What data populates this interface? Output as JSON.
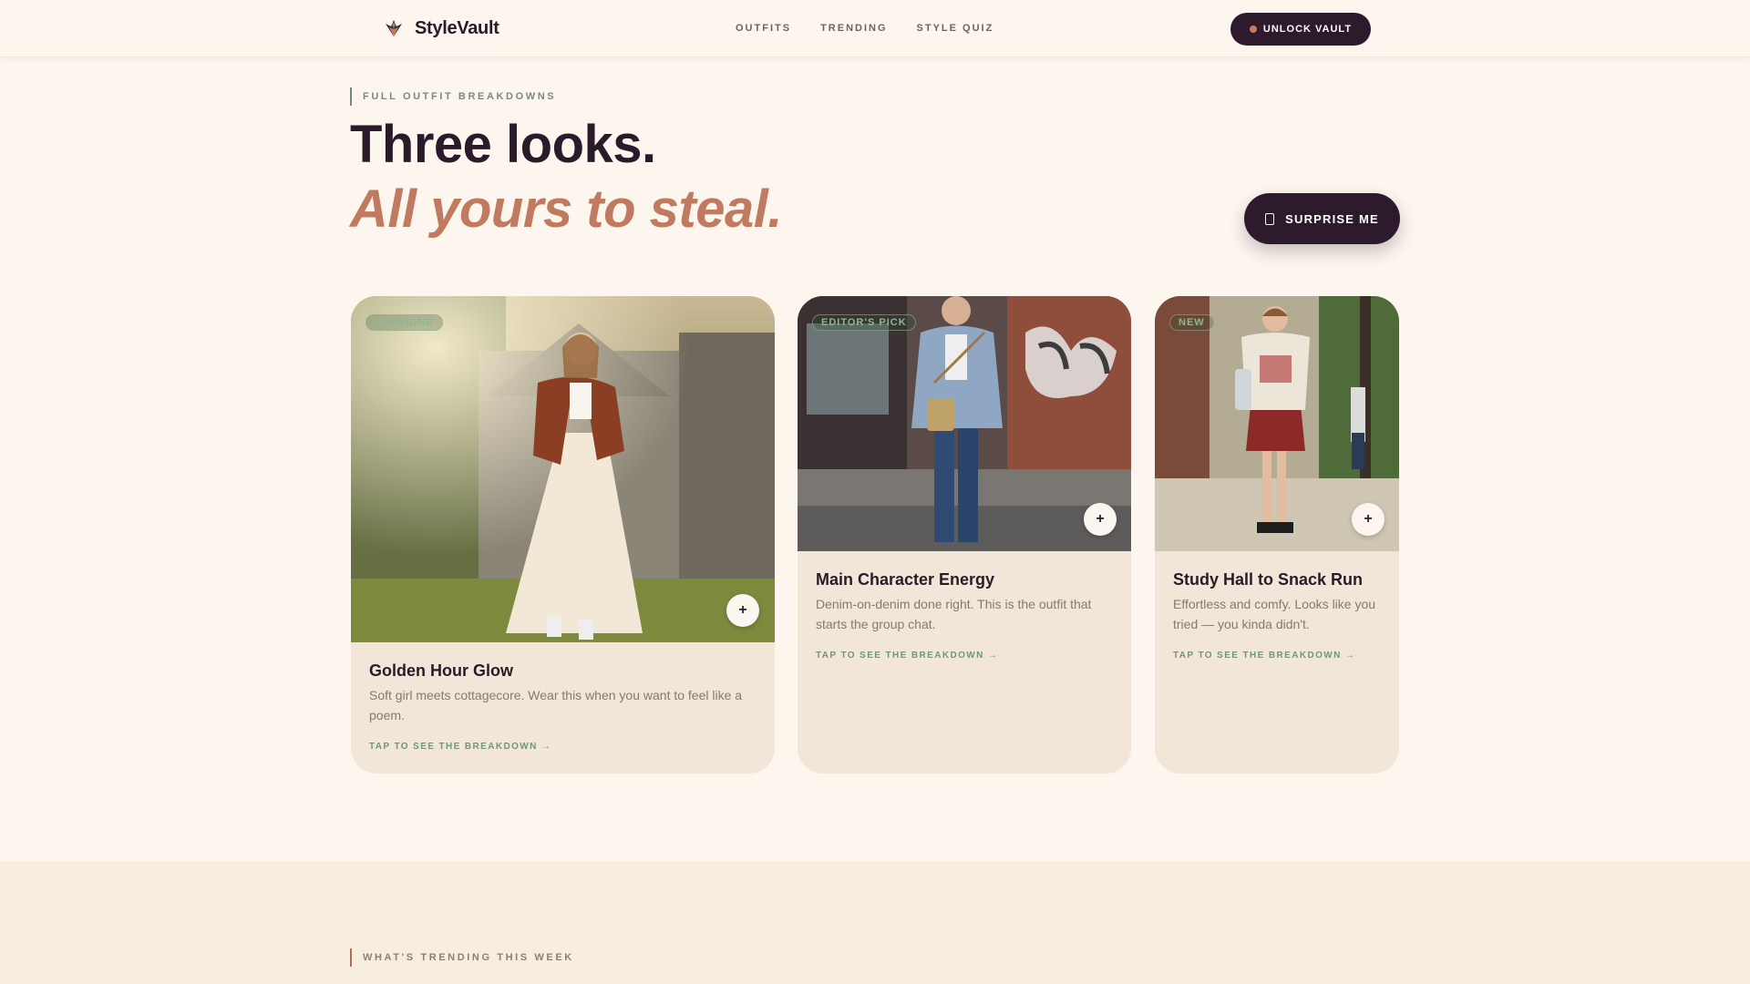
{
  "header": {
    "brand": "StyleVault",
    "nav": [
      "OUTFITS",
      "TRENDING",
      "STYLE QUIZ"
    ],
    "cta": "UNLOCK VAULT"
  },
  "hero": {
    "eyebrow": "FULL OUTFIT BREAKDOWNS",
    "title_line1": "Three looks.",
    "title_line2": "All yours to steal.",
    "button": "SURPRISE ME"
  },
  "cards": [
    {
      "badge": "TRENDING",
      "title": "Golden Hour Glow",
      "description": "Soft girl meets cottagecore. Wear this when you want to feel like a poem.",
      "link": "TAP TO SEE THE BREAKDOWN →",
      "plus": "+"
    },
    {
      "badge": "EDITOR'S PICK",
      "title": "Main Character Energy",
      "description": "Denim-on-denim done right. This is the outfit that starts the group chat.",
      "link": "TAP TO SEE THE BREAKDOWN →",
      "plus": "+"
    },
    {
      "badge": "NEW",
      "title": "Study Hall to Snack Run",
      "description": "Effortless and comfy. Looks like you tried — you kinda didn't.",
      "link": "TAP TO SEE THE BREAKDOWN →",
      "plus": "+"
    }
  ],
  "trending": {
    "eyebrow": "WHAT'S TRENDING THIS WEEK"
  },
  "colors": {
    "background": "#fcf6ee",
    "dark": "#2e1a2d",
    "accent": "#c07a60",
    "green": "#6e9a72"
  }
}
